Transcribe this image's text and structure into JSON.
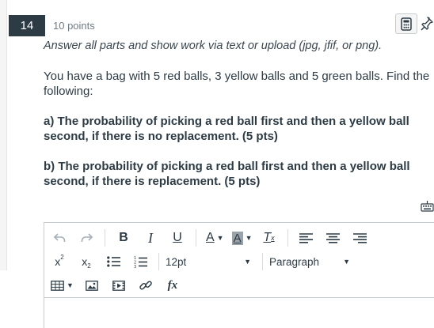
{
  "question": {
    "number": "14",
    "points": "10 points"
  },
  "header_icons": [
    "calculator-icon",
    "pin-icon"
  ],
  "body": {
    "instructions": "Answer all parts and show work via text or upload (jpg, jfif, or png).",
    "problem_line1": "You have a bag with 5 red balls, 3 yellow balls and 5 green balls. Find the",
    "problem_line2": "following:",
    "part_a_line1": "a) The probability of picking a red ball first and then a yellow ball",
    "part_a_line2": "second, if there is no replacement. (5 pts)",
    "part_b_line1": "b) The probability of picking a red ball first and then a yellow ball",
    "part_b_line2": "second, if there is replacement. (5 pts)"
  },
  "editor": {
    "font_size_value": "12pt",
    "block_format_value": "Paragraph",
    "toolbar_row1": [
      "undo-icon",
      "redo-icon",
      "bold-icon",
      "italic-icon",
      "underline-icon",
      "text-color-icon",
      "highlight-icon",
      "clear-formatting-icon",
      "align-left-icon",
      "align-center-icon",
      "align-right-icon"
    ],
    "toolbar_row2": [
      "superscript-icon",
      "subscript-icon",
      "bullet-list-icon",
      "numbered-list-icon"
    ],
    "toolbar_row3": [
      "table-icon",
      "image-icon",
      "media-icon",
      "link-icon",
      "equation-icon"
    ],
    "labels": {
      "bold": "B",
      "italic": "I",
      "underline": "U",
      "text_color": "A",
      "highlight": "A",
      "clear_formatting": "T",
      "superscript": "x",
      "subscript": "x",
      "equation": "fx"
    }
  },
  "colors": {
    "question_number_bg": "#2d3b45",
    "text": "#2d3b45",
    "muted": "#6f7b83",
    "border": "#c7cdd1"
  }
}
